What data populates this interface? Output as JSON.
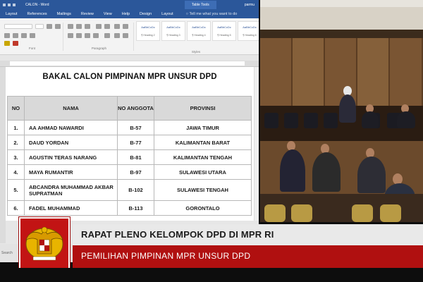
{
  "word": {
    "title": "CALON  -  Word",
    "context_tab": "Table Tools",
    "user": "parmu",
    "tabs": [
      "Layout",
      "References",
      "Mailings",
      "Review",
      "View",
      "Help",
      "Design",
      "Layout"
    ],
    "tell_me": "Tell me what you want to do",
    "style_samples": [
      {
        "sample": "AaBbCcDc",
        "name": "¶ Heading 2"
      },
      {
        "sample": "AaBbCcDc",
        "name": "¶ Heading 3"
      },
      {
        "sample": "AaBbCcDc",
        "name": "¶ Heading 4"
      },
      {
        "sample": "AaBbCcDc",
        "name": "¶ Heading 5"
      },
      {
        "sample": "AaBbCcDc",
        "name": "¶ Heading 6"
      }
    ],
    "group_labels": {
      "font": "Font",
      "paragraph": "Paragraph",
      "styles": "Styles"
    },
    "search_label": "Search"
  },
  "document": {
    "title": "BAKAL CALON PIMPINAN MPR UNSUR DPD",
    "headers": {
      "no": "NO",
      "nama": "NAMA",
      "anggota": "NO ANGGOTA",
      "provinsi": "PROVINSI"
    },
    "rows": [
      {
        "no": "1.",
        "nama": "AA AHMAD NAWARDI",
        "anggota": "B-57",
        "provinsi": "JAWA TIMUR"
      },
      {
        "no": "2.",
        "nama": "DAUD YORDAN",
        "anggota": "B-77",
        "provinsi": "KALIMANTAN BARAT"
      },
      {
        "no": "3.",
        "nama": "AGUSTIN TERAS NARANG",
        "anggota": "B-81",
        "provinsi": "KALIMANTAN TENGAH"
      },
      {
        "no": "4.",
        "nama": "MAYA RUMANTIR",
        "anggota": "B-97",
        "provinsi": "SULAWESI UTARA"
      },
      {
        "no": "5.",
        "nama": "ABCANDRA MUHAMMAD AKBAR SUPRATMAN",
        "anggota": "B-102",
        "provinsi": "SULAWESI TENGAH"
      },
      {
        "no": "6.",
        "nama": "FADEL MUHAMMAD",
        "anggota": "B-113",
        "provinsi": "GORONTALO"
      }
    ]
  },
  "broadcast": {
    "title": "RAPAT PLENO KELOMPOK DPD DI MPR RI",
    "subtitle": "PEMILIHAN PIMPINAN MPR UNSUR DPD",
    "logo_icon": "garuda-emblem-icon"
  },
  "colors": {
    "word_blue": "#2b579a",
    "banner_red": "#b01010",
    "logo_gold": "#e8b400"
  }
}
